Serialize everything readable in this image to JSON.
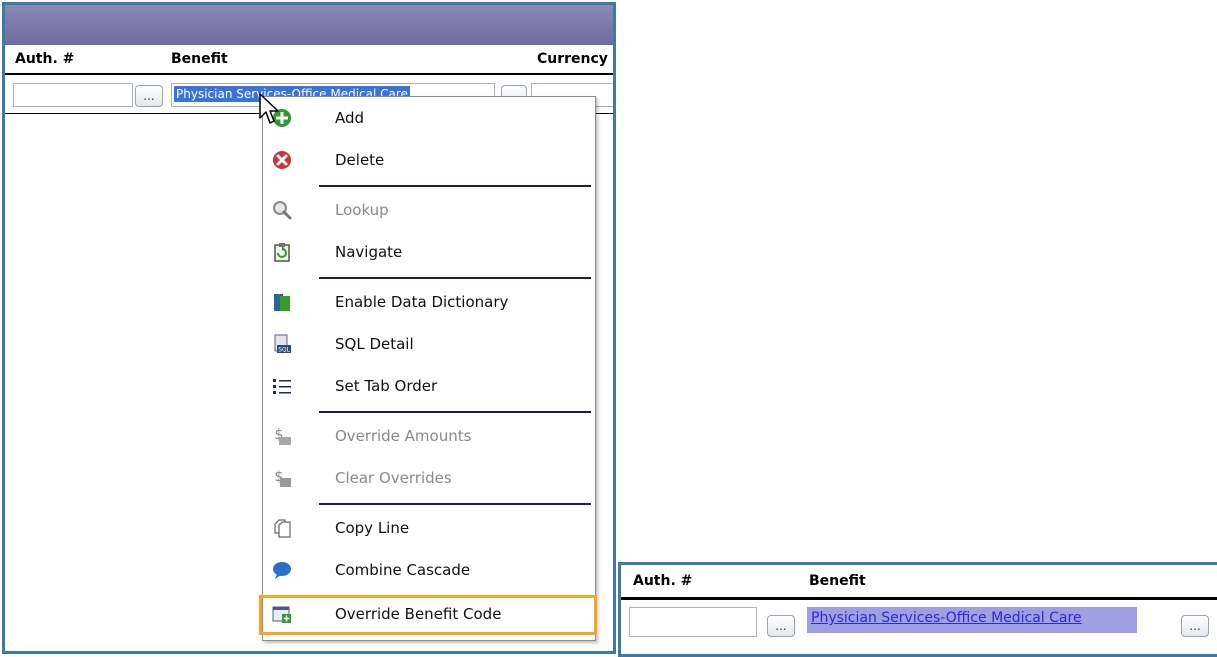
{
  "left_panel": {
    "columns": {
      "auth": "Auth. #",
      "benefit": "Benefit",
      "currency": "Currency"
    },
    "row": {
      "auth_value": "",
      "benefit_value": "Physician Services-Office Medical Care",
      "lookup_button": "...",
      "currency_value": ""
    }
  },
  "context_menu": {
    "items": [
      {
        "label": "Add",
        "icon": "add-icon",
        "enabled": true
      },
      {
        "label": "Delete",
        "icon": "delete-icon",
        "enabled": true
      },
      {
        "label": "Lookup",
        "icon": "lookup-icon",
        "enabled": false
      },
      {
        "label": "Navigate",
        "icon": "navigate-icon",
        "enabled": true
      },
      {
        "label": "Enable Data Dictionary",
        "icon": "data-dictionary-icon",
        "enabled": true
      },
      {
        "label": "SQL Detail",
        "icon": "sql-detail-icon",
        "enabled": true
      },
      {
        "label": "Set Tab Order",
        "icon": "tab-order-icon",
        "enabled": true
      },
      {
        "label": "Override Amounts",
        "icon": "override-amounts-icon",
        "enabled": false
      },
      {
        "label": "Clear Overrides",
        "icon": "clear-overrides-icon",
        "enabled": false
      },
      {
        "label": "Copy Line",
        "icon": "copy-line-icon",
        "enabled": true
      },
      {
        "label": "Combine Cascade",
        "icon": "combine-cascade-icon",
        "enabled": true
      },
      {
        "label": "Override Benefit Code",
        "icon": "override-benefit-code-icon",
        "enabled": true,
        "highlighted": true
      }
    ]
  },
  "right_panel": {
    "columns": {
      "auth": "Auth. #",
      "benefit": "Benefit"
    },
    "row": {
      "auth_value": "",
      "benefit_value": "Physician Services-Office Medical Care",
      "lookup_button": "..."
    }
  },
  "colors": {
    "panel_border": "#3f79a8",
    "title_bar": "#7a78a9",
    "selection": "#3b73d8",
    "overridden_field": "#9f9fe3",
    "highlight_outline": "#f6a623"
  }
}
